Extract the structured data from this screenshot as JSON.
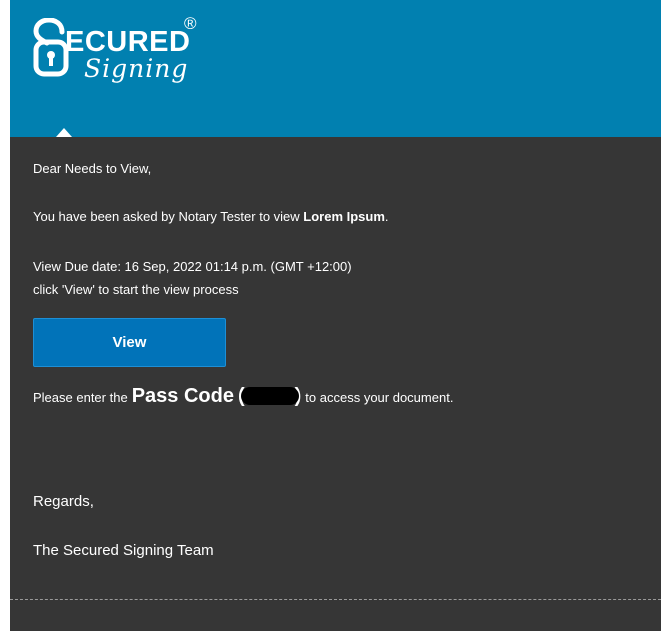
{
  "logo": {
    "brand_top": "ECURED",
    "brand_script": "Signing",
    "registered_mark": "®"
  },
  "email": {
    "greeting": "Dear Needs to View,",
    "request_prefix": "You have been asked by Notary Tester to view ",
    "document_name": "Lorem Ipsum",
    "request_suffix": ".",
    "due_date": "View Due date: 16 Sep, 2022 01:14 p.m. (GMT +12:00)",
    "instruction": "click 'View' to start the view process",
    "view_button_label": "View",
    "passcode_prefix": "Please enter the",
    "passcode_label": "Pass Code",
    "passcode_open": "(",
    "passcode_close": ")",
    "passcode_suffix": "to access your document.",
    "regards": "Regards,",
    "signature": "The Secured Signing Team"
  },
  "colors": {
    "header_bg": "#0180b0",
    "body_bg": "#363636",
    "button_bg": "#0173b9"
  }
}
